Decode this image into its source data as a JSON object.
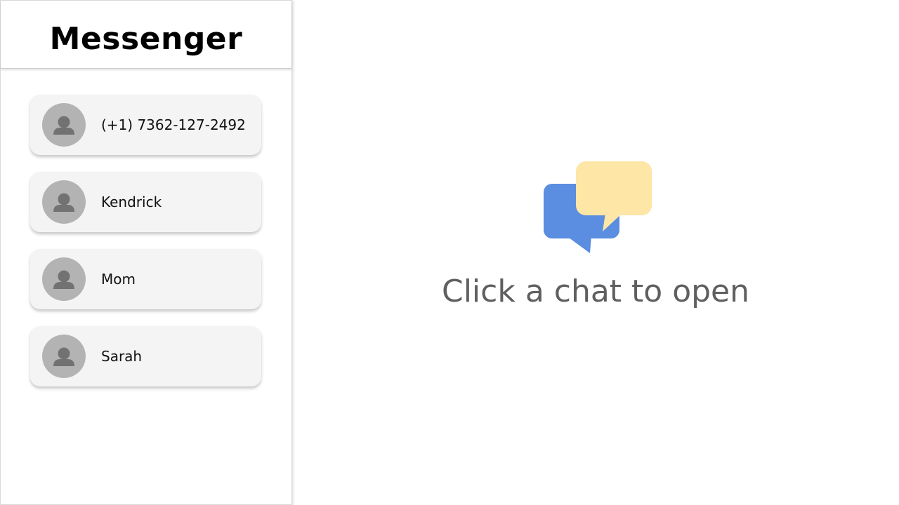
{
  "sidebar": {
    "title": "Messenger",
    "chats": [
      {
        "name": "(+1) 7362-127-2492",
        "avatar_icon": "person-icon"
      },
      {
        "name": "Kendrick",
        "avatar_icon": "person-icon"
      },
      {
        "name": "Mom",
        "avatar_icon": "person-icon"
      },
      {
        "name": "Sarah",
        "avatar_icon": "person-icon"
      }
    ]
  },
  "main": {
    "empty_state_icon": "chat-bubbles-icon",
    "empty_state_text": "Click a chat to open"
  },
  "colors": {
    "bubble_blue": "#5b8de0",
    "bubble_yellow": "#fde6a6",
    "avatar_bg": "#b3b3b3",
    "avatar_fg": "#727272",
    "card_bg": "#f4f4f4"
  }
}
